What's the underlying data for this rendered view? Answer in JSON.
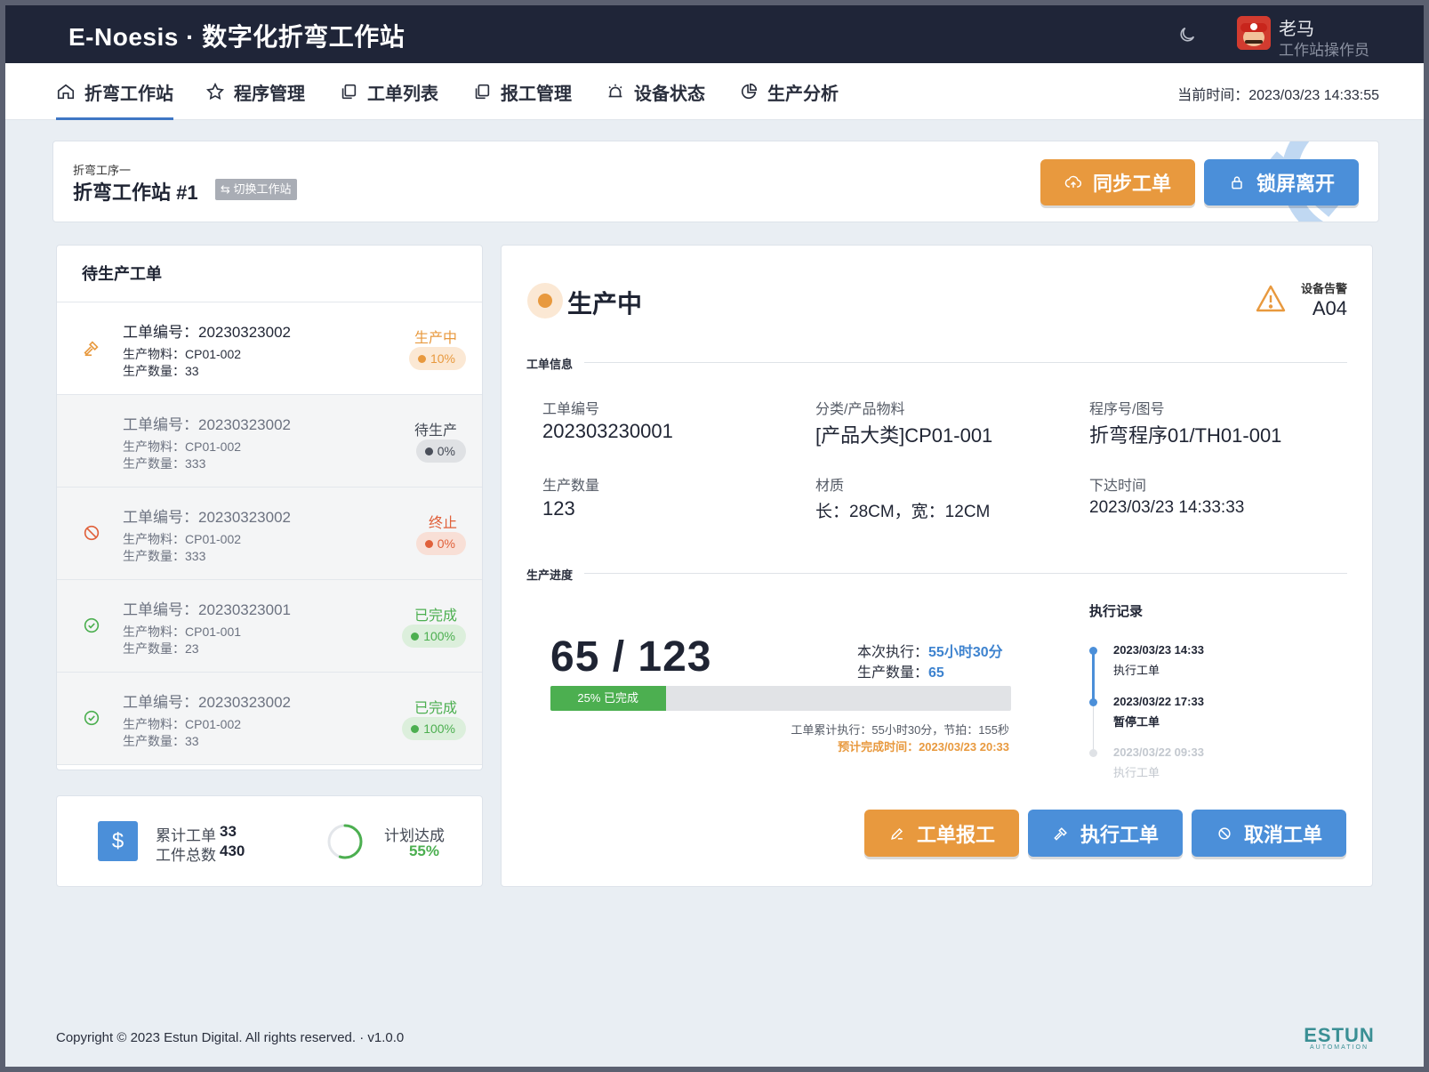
{
  "header": {
    "brand": "E-Noesis · 数字化折弯工作站",
    "user_name": "老马",
    "user_role": "工作站操作员"
  },
  "nav": {
    "items": [
      {
        "label": "折弯工作站",
        "icon": "home-icon"
      },
      {
        "label": "程序管理",
        "icon": "star-icon"
      },
      {
        "label": "工单列表",
        "icon": "copy-icon"
      },
      {
        "label": "报工管理",
        "icon": "copy-icon"
      },
      {
        "label": "设备状态",
        "icon": "alarm-icon"
      },
      {
        "label": "生产分析",
        "icon": "pie-chart-icon"
      }
    ],
    "clock": "当前时间：2023/03/23 14:33:55"
  },
  "station": {
    "subtitle": "折弯工序一",
    "title": "折弯工作站 #1",
    "switch_label": "⇆ 切换工作站",
    "sync_label": "同步工单",
    "lock_label": "锁屏离开"
  },
  "pending": {
    "title": "待生产工单",
    "orders": [
      {
        "no": "工单编号：20230323002",
        "material": "生产物料：CP01-002",
        "qty": "生产数量：33",
        "status": "生产中",
        "percent": "10%"
      },
      {
        "no": "工单编号：20230323002",
        "material": "生产物料：CP01-002",
        "qty": "生产数量：333",
        "status": "待生产",
        "percent": "0%"
      },
      {
        "no": "工单编号：20230323002",
        "material": "生产物料：CP01-002",
        "qty": "生产数量：333",
        "status": "终止",
        "percent": "0%"
      },
      {
        "no": "工单编号：20230323001",
        "material": "生产物料：CP01-001",
        "qty": "生产数量：23",
        "status": "已完成",
        "percent": "100%"
      },
      {
        "no": "工单编号：20230323002",
        "material": "生产物料：CP01-002",
        "qty": "生产数量：33",
        "status": "已完成",
        "percent": "100%"
      }
    ]
  },
  "summary": {
    "total_orders_label": "累计工单",
    "total_orders": "33",
    "total_parts_label": "工件总数",
    "total_parts": "430",
    "plan_label": "计划达成",
    "plan_value": "55%",
    "plan_fraction": 0.55
  },
  "detail": {
    "status": "生产中",
    "alarm_label": "设备告警",
    "alarm_code": "A04",
    "info_label": "工单信息",
    "fields": {
      "order_no_label": "工单编号",
      "order_no": "202303230001",
      "category_label": "分类/产品物料",
      "category": "[产品大类]CP01-001",
      "program_label": "程序号/图号",
      "program": "折弯程序01/TH01-001",
      "qty_label": "生产数量",
      "qty": "123",
      "material_label": "材质",
      "material": "长：28CM，宽：12CM",
      "issued_label": "下达时间",
      "issued": "2023/03/23 14:33:33"
    },
    "progress_label": "生产进度",
    "progress_text": "65 / 123",
    "progress_fraction": 0.25,
    "progress_bar_label": "25% 已完成",
    "exec_label": "本次执行：",
    "exec_value": "55小时30分",
    "exec_qty_label": "生产数量：",
    "exec_qty_value": "65",
    "accumulated": "工单累计执行：55小时30分，节拍：155秒",
    "eta": "预计完成时间：2023/03/23 20:33",
    "log_title": "执行记录",
    "log": [
      {
        "time": "2023/03/23 14:33",
        "action": "执行工单"
      },
      {
        "time": "2023/03/22 17:33",
        "action": "暂停工单"
      },
      {
        "time": "2023/03/22 09:33",
        "action": "执行工单"
      }
    ],
    "report_label": "工单报工",
    "execute_label": "执行工单",
    "cancel_label": "取消工单"
  },
  "footer": {
    "copyright": "Copyright © 2023 Estun Digital. All rights reserved.  · v1.0.0",
    "logo": "ESTUN",
    "logo_sub": "AUTOMATION"
  },
  "colors": {
    "accent": "#4b8fd9",
    "warning": "#e8993e",
    "success": "#4caf50",
    "danger": "#e0603a",
    "header": "#1f2538"
  }
}
